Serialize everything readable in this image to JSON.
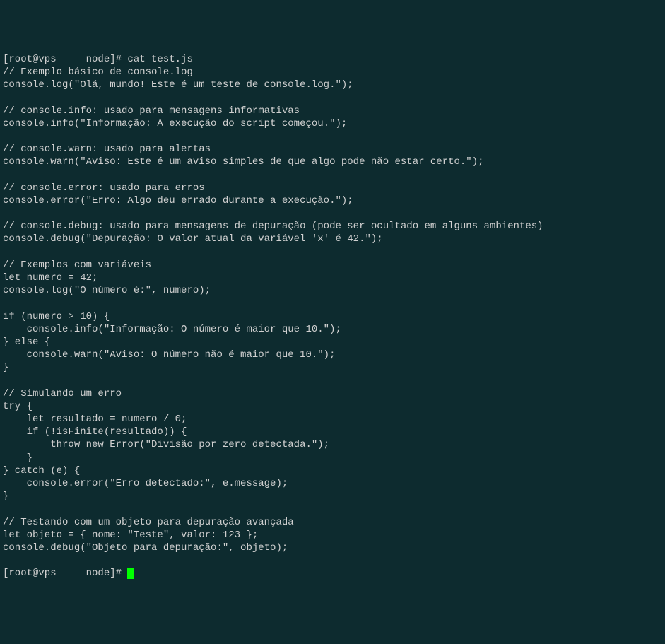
{
  "prompt1": {
    "full": "[root@vps     node]# cat test.js"
  },
  "code": {
    "l1": "// Exemplo básico de console.log",
    "l2": "console.log(\"Olá, mundo! Este é um teste de console.log.\");",
    "l3": "",
    "l4": "// console.info: usado para mensagens informativas",
    "l5": "console.info(\"Informação: A execução do script começou.\");",
    "l6": "",
    "l7": "// console.warn: usado para alertas",
    "l8": "console.warn(\"Aviso: Este é um aviso simples de que algo pode não estar certo.\");",
    "l9": "",
    "l10": "// console.error: usado para erros",
    "l11": "console.error(\"Erro: Algo deu errado durante a execução.\");",
    "l12": "",
    "l13": "// console.debug: usado para mensagens de depuração (pode ser ocultado em alguns ambientes)",
    "l14": "console.debug(\"Depuração: O valor atual da variável 'x' é 42.\");",
    "l15": "",
    "l16": "// Exemplos com variáveis",
    "l17": "let numero = 42;",
    "l18": "console.log(\"O número é:\", numero);",
    "l19": "",
    "l20": "if (numero > 10) {",
    "l21": "    console.info(\"Informação: O número é maior que 10.\");",
    "l22": "} else {",
    "l23": "    console.warn(\"Aviso: O número não é maior que 10.\");",
    "l24": "}",
    "l25": "",
    "l26": "// Simulando um erro",
    "l27": "try {",
    "l28": "    let resultado = numero / 0;",
    "l29": "    if (!isFinite(resultado)) {",
    "l30": "        throw new Error(\"Divisão por zero detectada.\");",
    "l31": "    }",
    "l32": "} catch (e) {",
    "l33": "    console.error(\"Erro detectado:\", e.message);",
    "l34": "}",
    "l35": "",
    "l36": "// Testando com um objeto para depuração avançada",
    "l37": "let objeto = { nome: \"Teste\", valor: 123 };",
    "l38": "console.debug(\"Objeto para depuração:\", objeto);",
    "l39": ""
  },
  "prompt2": {
    "full": "[root@vps     node]# "
  }
}
